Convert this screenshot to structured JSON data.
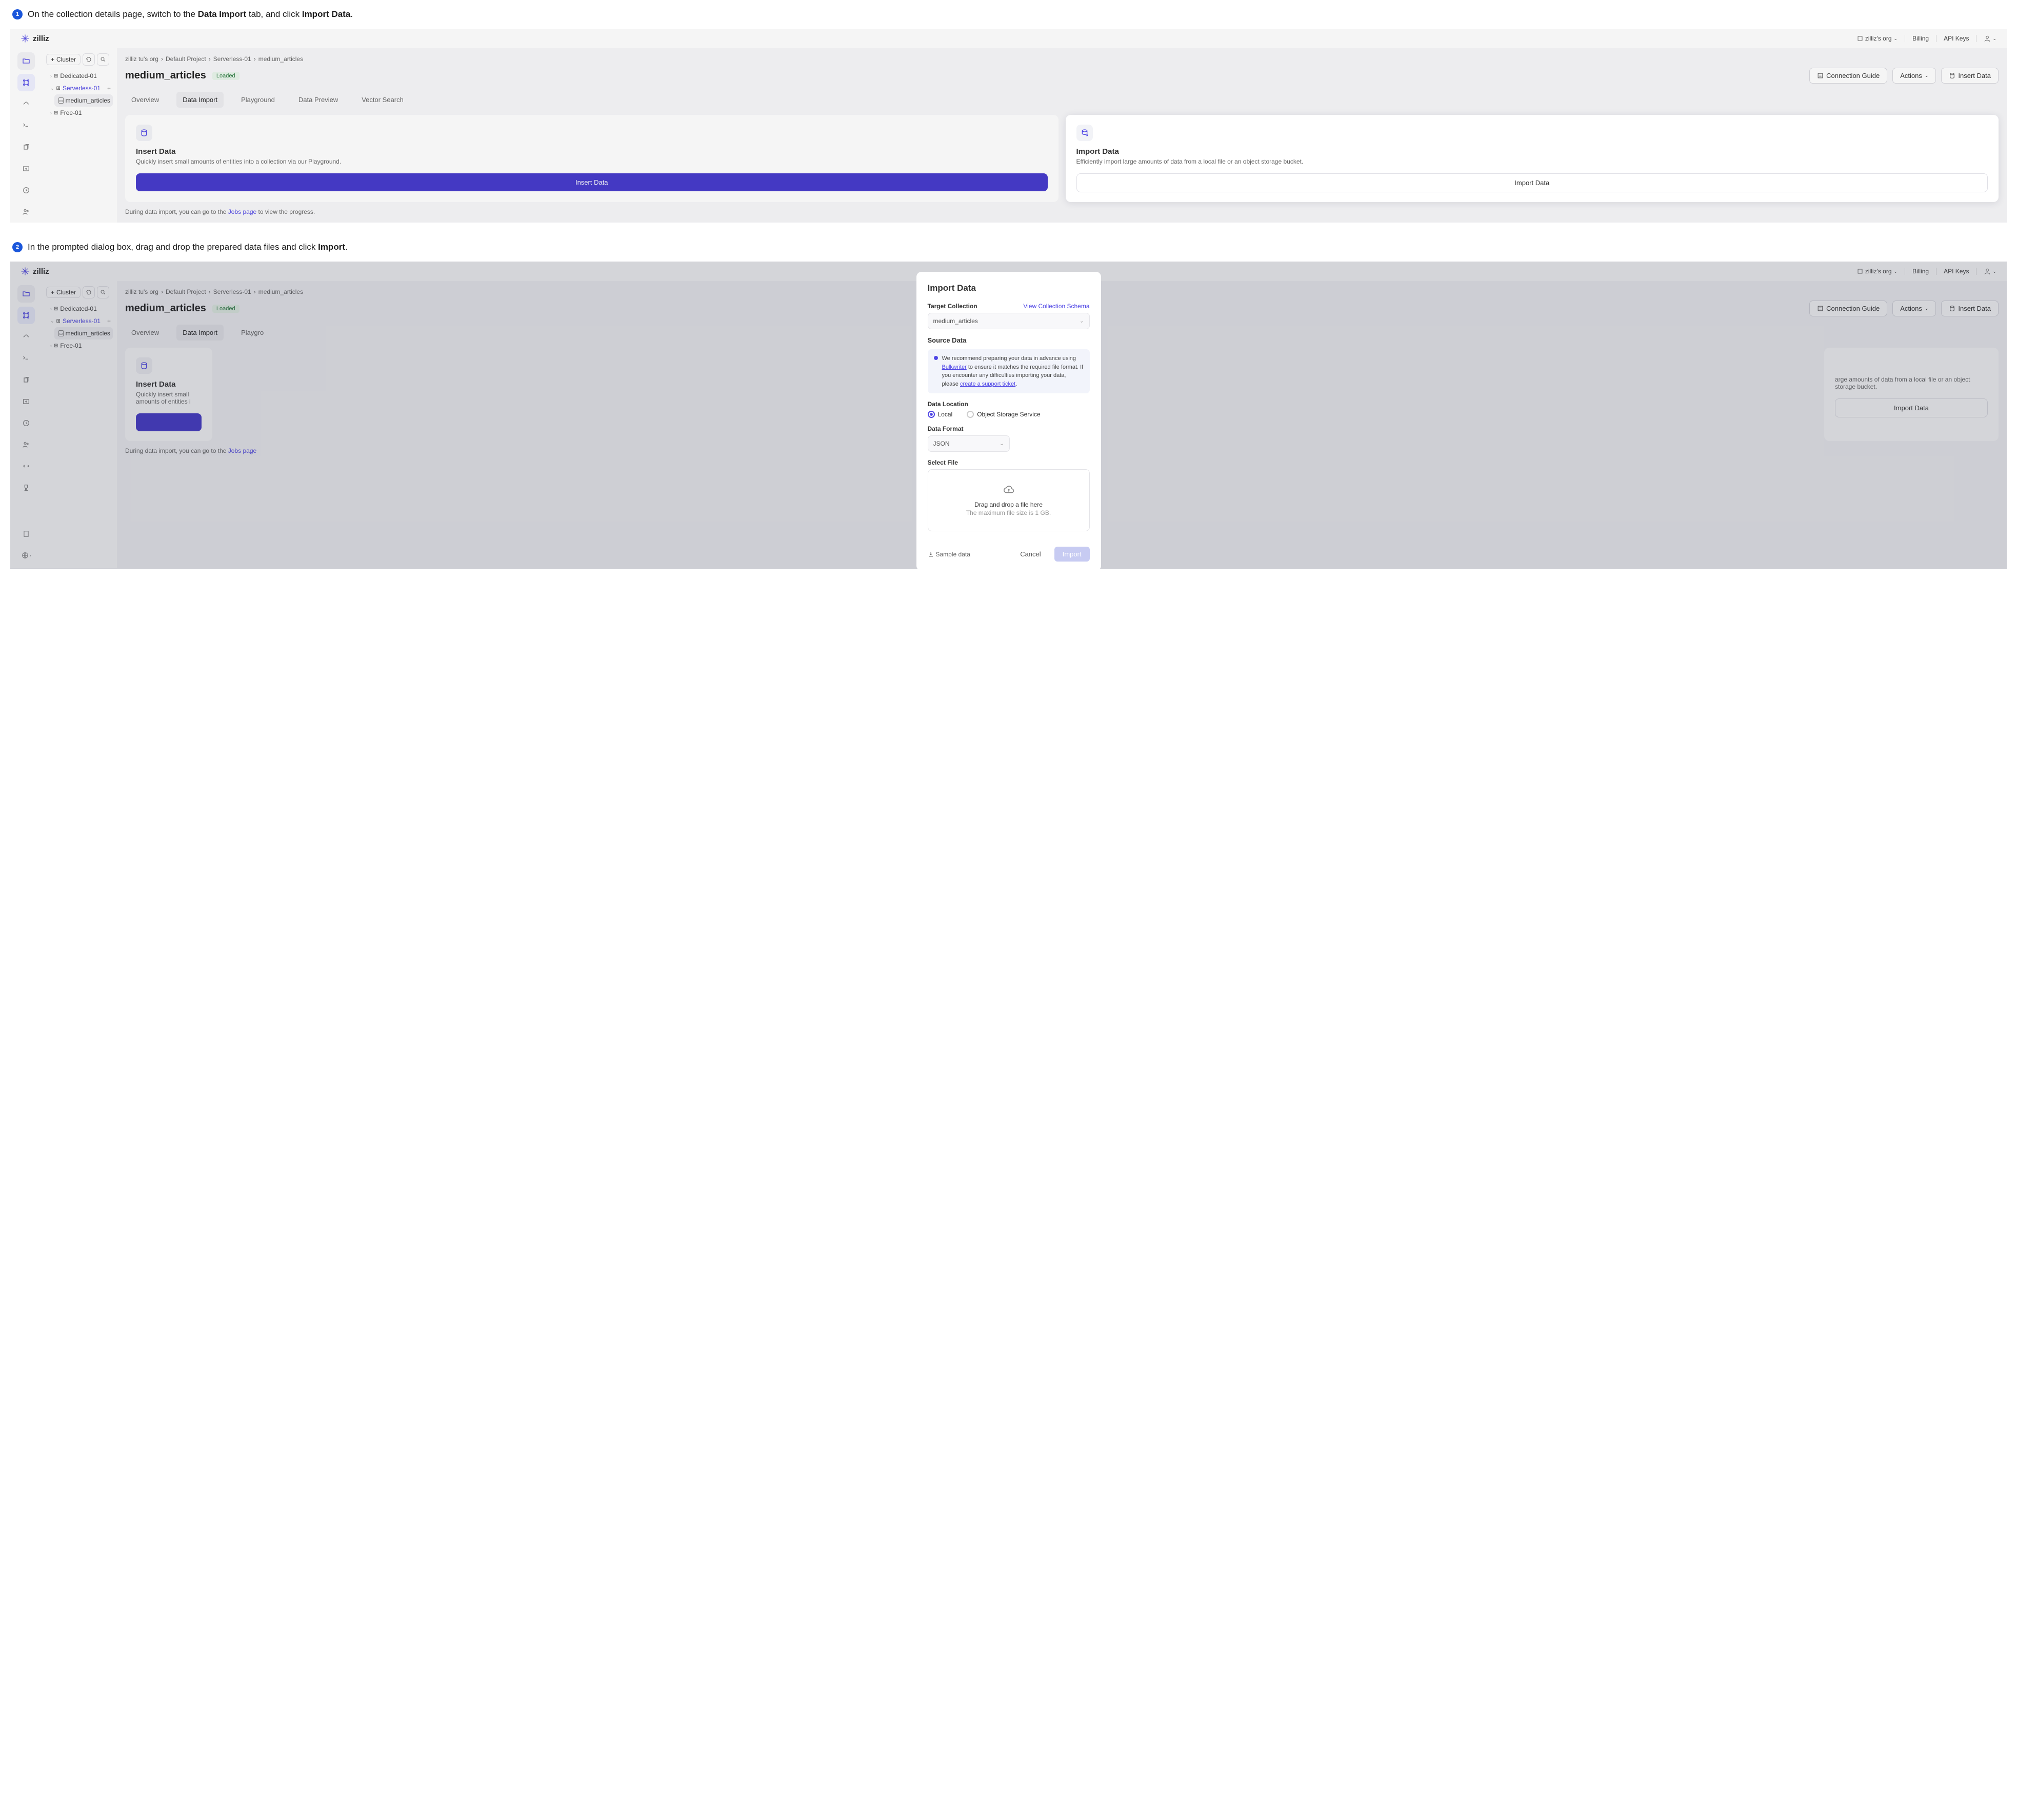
{
  "brand": "zilliz",
  "step1": {
    "num": "1",
    "text_pre": "On the collection details page, switch to the ",
    "bold1": "Data Import",
    "text_mid": " tab, and click ",
    "bold2": "Import Data",
    "text_end": "."
  },
  "step2": {
    "num": "2",
    "text_pre": "In the prompted dialog box, drag and drop the prepared data files and click ",
    "bold1": "Import",
    "text_end": "."
  },
  "topbar": {
    "org": "zilliz's org",
    "billing": "Billing",
    "api_keys": "API Keys"
  },
  "sidebar": {
    "cluster_btn": "Cluster",
    "tree": {
      "dedicated": "Dedicated-01",
      "serverless": "Serverless-01",
      "collection": "medium_articles",
      "free": "Free-01"
    }
  },
  "breadcrumb": [
    "zilliz tu's org",
    "Default Project",
    "Serverless-01",
    "medium_articles"
  ],
  "page": {
    "title": "medium_articles",
    "status": "Loaded",
    "connection_guide": "Connection Guide",
    "actions": "Actions",
    "insert_data": "Insert Data"
  },
  "tabs": [
    "Overview",
    "Data Import",
    "Playground",
    "Data Preview",
    "Vector Search"
  ],
  "card_insert": {
    "title": "Insert Data",
    "desc": "Quickly insert small amounts of entities into a collection via our Playground.",
    "btn": "Insert Data",
    "desc_trunc": "Quickly insert small amounts of entities i"
  },
  "card_import": {
    "title": "Import Data",
    "desc": "Efficiently import large amounts of data from a local file or an object storage bucket.",
    "desc_trunc": "arge amounts of data from a local file or an object storage bucket.",
    "btn": "Import Data"
  },
  "footer": {
    "pre": "During data import, you can go to the ",
    "link": "Jobs page",
    "post": " to view the progress."
  },
  "modal": {
    "title": "Import Data",
    "target_label": "Target Collection",
    "view_schema": "View Collection Schema",
    "target_value": "medium_articles",
    "source_data": "Source Data",
    "info_pre": "We recommend preparing your data in advance using ",
    "info_link1": "Bulkwriter",
    "info_mid": " to ensure it matches the required file format. If you encounter any difficulties importing your data, please ",
    "info_link2": "create a support ticket",
    "info_end": ".",
    "data_location": "Data Location",
    "loc_local": "Local",
    "loc_oss": "Object Storage Service",
    "data_format": "Data Format",
    "format_value": "JSON",
    "select_file": "Select File",
    "drop_main": "Drag and drop a file here",
    "drop_sub": "The maximum file size is 1 GB.",
    "sample": "Sample data",
    "cancel": "Cancel",
    "import": "Import"
  }
}
